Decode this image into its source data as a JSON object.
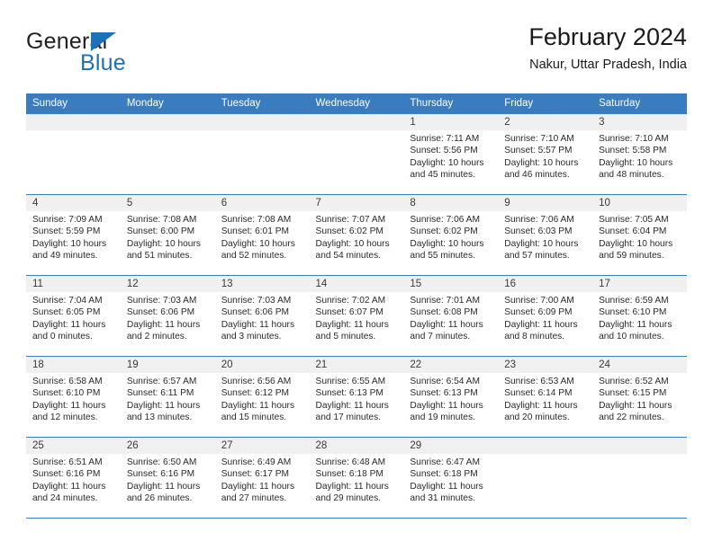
{
  "brand": {
    "name_part1": "General",
    "name_part2": "Blue",
    "triangle_color": "#1b72b8"
  },
  "header": {
    "title": "February 2024",
    "subtitle": "Nakur, Uttar Pradesh, India"
  },
  "theme": {
    "header_blue": "#3a7cc0",
    "daynum_band": "#f0f0f0",
    "text": "#2a2a2a"
  },
  "labels": {
    "sunrise_prefix": "Sunrise:",
    "sunset_prefix": "Sunset:",
    "daylight_prefix": "Daylight:"
  },
  "weekdays": [
    "Sunday",
    "Monday",
    "Tuesday",
    "Wednesday",
    "Thursday",
    "Friday",
    "Saturday"
  ],
  "weeks": [
    [
      {
        "day": "",
        "sunrise": "",
        "sunset": "",
        "daylight_line1": "",
        "daylight_line2": ""
      },
      {
        "day": "",
        "sunrise": "",
        "sunset": "",
        "daylight_line1": "",
        "daylight_line2": ""
      },
      {
        "day": "",
        "sunrise": "",
        "sunset": "",
        "daylight_line1": "",
        "daylight_line2": ""
      },
      {
        "day": "",
        "sunrise": "",
        "sunset": "",
        "daylight_line1": "",
        "daylight_line2": ""
      },
      {
        "day": "1",
        "sunrise": "Sunrise: 7:11 AM",
        "sunset": "Sunset: 5:56 PM",
        "daylight_line1": "Daylight: 10 hours",
        "daylight_line2": "and 45 minutes."
      },
      {
        "day": "2",
        "sunrise": "Sunrise: 7:10 AM",
        "sunset": "Sunset: 5:57 PM",
        "daylight_line1": "Daylight: 10 hours",
        "daylight_line2": "and 46 minutes."
      },
      {
        "day": "3",
        "sunrise": "Sunrise: 7:10 AM",
        "sunset": "Sunset: 5:58 PM",
        "daylight_line1": "Daylight: 10 hours",
        "daylight_line2": "and 48 minutes."
      }
    ],
    [
      {
        "day": "4",
        "sunrise": "Sunrise: 7:09 AM",
        "sunset": "Sunset: 5:59 PM",
        "daylight_line1": "Daylight: 10 hours",
        "daylight_line2": "and 49 minutes."
      },
      {
        "day": "5",
        "sunrise": "Sunrise: 7:08 AM",
        "sunset": "Sunset: 6:00 PM",
        "daylight_line1": "Daylight: 10 hours",
        "daylight_line2": "and 51 minutes."
      },
      {
        "day": "6",
        "sunrise": "Sunrise: 7:08 AM",
        "sunset": "Sunset: 6:01 PM",
        "daylight_line1": "Daylight: 10 hours",
        "daylight_line2": "and 52 minutes."
      },
      {
        "day": "7",
        "sunrise": "Sunrise: 7:07 AM",
        "sunset": "Sunset: 6:02 PM",
        "daylight_line1": "Daylight: 10 hours",
        "daylight_line2": "and 54 minutes."
      },
      {
        "day": "8",
        "sunrise": "Sunrise: 7:06 AM",
        "sunset": "Sunset: 6:02 PM",
        "daylight_line1": "Daylight: 10 hours",
        "daylight_line2": "and 55 minutes."
      },
      {
        "day": "9",
        "sunrise": "Sunrise: 7:06 AM",
        "sunset": "Sunset: 6:03 PM",
        "daylight_line1": "Daylight: 10 hours",
        "daylight_line2": "and 57 minutes."
      },
      {
        "day": "10",
        "sunrise": "Sunrise: 7:05 AM",
        "sunset": "Sunset: 6:04 PM",
        "daylight_line1": "Daylight: 10 hours",
        "daylight_line2": "and 59 minutes."
      }
    ],
    [
      {
        "day": "11",
        "sunrise": "Sunrise: 7:04 AM",
        "sunset": "Sunset: 6:05 PM",
        "daylight_line1": "Daylight: 11 hours",
        "daylight_line2": "and 0 minutes."
      },
      {
        "day": "12",
        "sunrise": "Sunrise: 7:03 AM",
        "sunset": "Sunset: 6:06 PM",
        "daylight_line1": "Daylight: 11 hours",
        "daylight_line2": "and 2 minutes."
      },
      {
        "day": "13",
        "sunrise": "Sunrise: 7:03 AM",
        "sunset": "Sunset: 6:06 PM",
        "daylight_line1": "Daylight: 11 hours",
        "daylight_line2": "and 3 minutes."
      },
      {
        "day": "14",
        "sunrise": "Sunrise: 7:02 AM",
        "sunset": "Sunset: 6:07 PM",
        "daylight_line1": "Daylight: 11 hours",
        "daylight_line2": "and 5 minutes."
      },
      {
        "day": "15",
        "sunrise": "Sunrise: 7:01 AM",
        "sunset": "Sunset: 6:08 PM",
        "daylight_line1": "Daylight: 11 hours",
        "daylight_line2": "and 7 minutes."
      },
      {
        "day": "16",
        "sunrise": "Sunrise: 7:00 AM",
        "sunset": "Sunset: 6:09 PM",
        "daylight_line1": "Daylight: 11 hours",
        "daylight_line2": "and 8 minutes."
      },
      {
        "day": "17",
        "sunrise": "Sunrise: 6:59 AM",
        "sunset": "Sunset: 6:10 PM",
        "daylight_line1": "Daylight: 11 hours",
        "daylight_line2": "and 10 minutes."
      }
    ],
    [
      {
        "day": "18",
        "sunrise": "Sunrise: 6:58 AM",
        "sunset": "Sunset: 6:10 PM",
        "daylight_line1": "Daylight: 11 hours",
        "daylight_line2": "and 12 minutes."
      },
      {
        "day": "19",
        "sunrise": "Sunrise: 6:57 AM",
        "sunset": "Sunset: 6:11 PM",
        "daylight_line1": "Daylight: 11 hours",
        "daylight_line2": "and 13 minutes."
      },
      {
        "day": "20",
        "sunrise": "Sunrise: 6:56 AM",
        "sunset": "Sunset: 6:12 PM",
        "daylight_line1": "Daylight: 11 hours",
        "daylight_line2": "and 15 minutes."
      },
      {
        "day": "21",
        "sunrise": "Sunrise: 6:55 AM",
        "sunset": "Sunset: 6:13 PM",
        "daylight_line1": "Daylight: 11 hours",
        "daylight_line2": "and 17 minutes."
      },
      {
        "day": "22",
        "sunrise": "Sunrise: 6:54 AM",
        "sunset": "Sunset: 6:13 PM",
        "daylight_line1": "Daylight: 11 hours",
        "daylight_line2": "and 19 minutes."
      },
      {
        "day": "23",
        "sunrise": "Sunrise: 6:53 AM",
        "sunset": "Sunset: 6:14 PM",
        "daylight_line1": "Daylight: 11 hours",
        "daylight_line2": "and 20 minutes."
      },
      {
        "day": "24",
        "sunrise": "Sunrise: 6:52 AM",
        "sunset": "Sunset: 6:15 PM",
        "daylight_line1": "Daylight: 11 hours",
        "daylight_line2": "and 22 minutes."
      }
    ],
    [
      {
        "day": "25",
        "sunrise": "Sunrise: 6:51 AM",
        "sunset": "Sunset: 6:16 PM",
        "daylight_line1": "Daylight: 11 hours",
        "daylight_line2": "and 24 minutes."
      },
      {
        "day": "26",
        "sunrise": "Sunrise: 6:50 AM",
        "sunset": "Sunset: 6:16 PM",
        "daylight_line1": "Daylight: 11 hours",
        "daylight_line2": "and 26 minutes."
      },
      {
        "day": "27",
        "sunrise": "Sunrise: 6:49 AM",
        "sunset": "Sunset: 6:17 PM",
        "daylight_line1": "Daylight: 11 hours",
        "daylight_line2": "and 27 minutes."
      },
      {
        "day": "28",
        "sunrise": "Sunrise: 6:48 AM",
        "sunset": "Sunset: 6:18 PM",
        "daylight_line1": "Daylight: 11 hours",
        "daylight_line2": "and 29 minutes."
      },
      {
        "day": "29",
        "sunrise": "Sunrise: 6:47 AM",
        "sunset": "Sunset: 6:18 PM",
        "daylight_line1": "Daylight: 11 hours",
        "daylight_line2": "and 31 minutes."
      },
      {
        "day": "",
        "sunrise": "",
        "sunset": "",
        "daylight_line1": "",
        "daylight_line2": ""
      },
      {
        "day": "",
        "sunrise": "",
        "sunset": "",
        "daylight_line1": "",
        "daylight_line2": ""
      }
    ]
  ]
}
